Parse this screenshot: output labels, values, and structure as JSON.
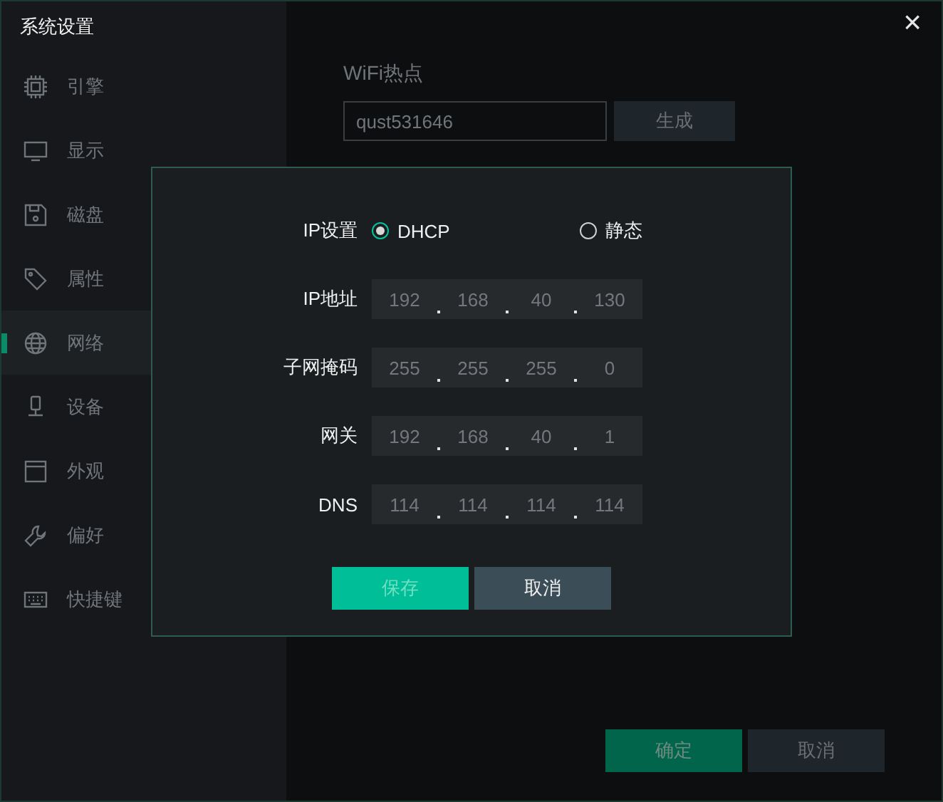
{
  "window": {
    "title": "系统设置",
    "close": "×"
  },
  "sidebar": {
    "items": [
      {
        "label": "引擎",
        "selected": false
      },
      {
        "label": "显示",
        "selected": false
      },
      {
        "label": "磁盘",
        "selected": false
      },
      {
        "label": "属性",
        "selected": false
      },
      {
        "label": "网络",
        "selected": true
      },
      {
        "label": "设备",
        "selected": false
      },
      {
        "label": "外观",
        "selected": false
      },
      {
        "label": "偏好",
        "selected": false
      },
      {
        "label": "快捷键",
        "selected": false
      }
    ]
  },
  "wifi": {
    "label": "WiFi热点",
    "value": "qust531646",
    "button": "生成"
  },
  "dialog": {
    "mode_label": "IP设置",
    "modes": [
      {
        "label": "DHCP",
        "selected": true
      },
      {
        "label": "静态",
        "selected": false
      }
    ],
    "fields": [
      {
        "label": "IP地址",
        "octets": [
          "192",
          "168",
          "40",
          "130"
        ]
      },
      {
        "label": "子网掩码",
        "octets": [
          "255",
          "255",
          "255",
          "0"
        ]
      },
      {
        "label": "网关",
        "octets": [
          "192",
          "168",
          "40",
          "1"
        ]
      },
      {
        "label": "DNS",
        "octets": [
          "114",
          "114",
          "114",
          "114"
        ]
      }
    ],
    "buttons": [
      "保存",
      "取消"
    ]
  },
  "footer_buttons": [
    "确定",
    "取消"
  ]
}
